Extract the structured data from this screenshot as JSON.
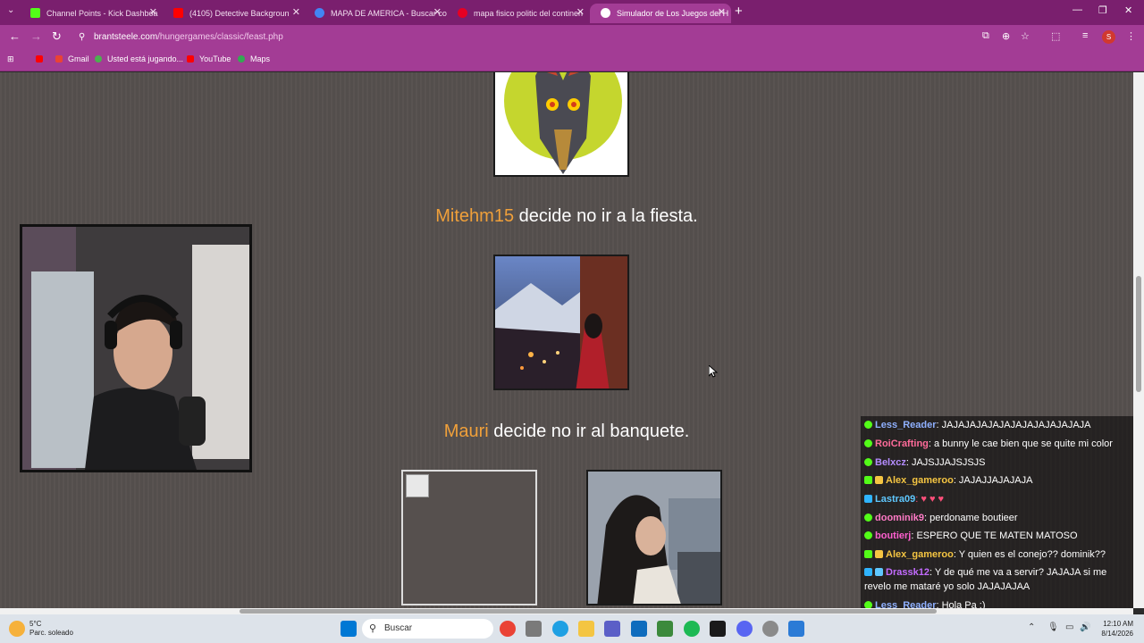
{
  "tabs": [
    {
      "title": "Channel Points - Kick Dashboa",
      "color": "#53fc18"
    },
    {
      "title": "(4105) Detective Backgroun",
      "color": "#ff0000"
    },
    {
      "title": "MAPA DE AMERICA - Buscar co",
      "color": "#4285f4"
    },
    {
      "title": "mapa fisico politic del continen",
      "color": "#e60023"
    },
    {
      "title": "Simulador de Los Juegos del H",
      "color": "#ffffff"
    }
  ],
  "url": {
    "host": "brantsteele.com",
    "path": "/hungergames/classic/feast.php"
  },
  "bookmarks": [
    "Gmail",
    "Usted está jugando...",
    "YouTube",
    "Maps"
  ],
  "profile_initial": "S",
  "events": [
    {
      "name": "Mitehm15",
      "text": " decide no ir a la fiesta."
    },
    {
      "name": "Mauri",
      "text": " decide no ir al banquete."
    }
  ],
  "chat": [
    {
      "user": "Less_Reader",
      "color": "#8fb0ff",
      "text": ": JAJAJAJAJAJAJAJAJAJAJAJAJA"
    },
    {
      "user": "RoiCrafting",
      "color": "#ff6b9a",
      "text": ": a bunny le cae bien que se quite mi color"
    },
    {
      "user": "Belxcz",
      "color": "#b48cff",
      "text": ": JAJSJJAJSJSJS"
    },
    {
      "user": "Alex_gameroo",
      "color": "#f5c542",
      "text": ": JAJAJJAJAJAJA"
    },
    {
      "user": "Lastra09",
      "color": "#5fc8ff",
      "text": ": ♥ ♥ ♥"
    },
    {
      "user": "doominik9",
      "color": "#ff7ac6",
      "text": ": perdoname boutieer"
    },
    {
      "user": "boutierj",
      "color": "#ff5fd0",
      "text": ": ESPERO QUE TE MATEN MATOSO"
    },
    {
      "user": "Alex_gameroo",
      "color": "#f5c542",
      "text": ": Y quien es el conejo?? dominik??"
    },
    {
      "user": "Drassk12",
      "color": "#c36bff",
      "text": ": Y de qué me va a servir? JAJAJA si me revelo me mataré yo solo JAJAJAJAA"
    },
    {
      "user": "Less_Reader",
      "color": "#8fb0ff",
      "text": ": Hola Pa :)"
    }
  ],
  "taskbar": {
    "search_placeholder": "Buscar",
    "temperature": "5°C",
    "weather": "Parc. soleado",
    "time": "12:10 AM",
    "date": "8/14/2026"
  }
}
